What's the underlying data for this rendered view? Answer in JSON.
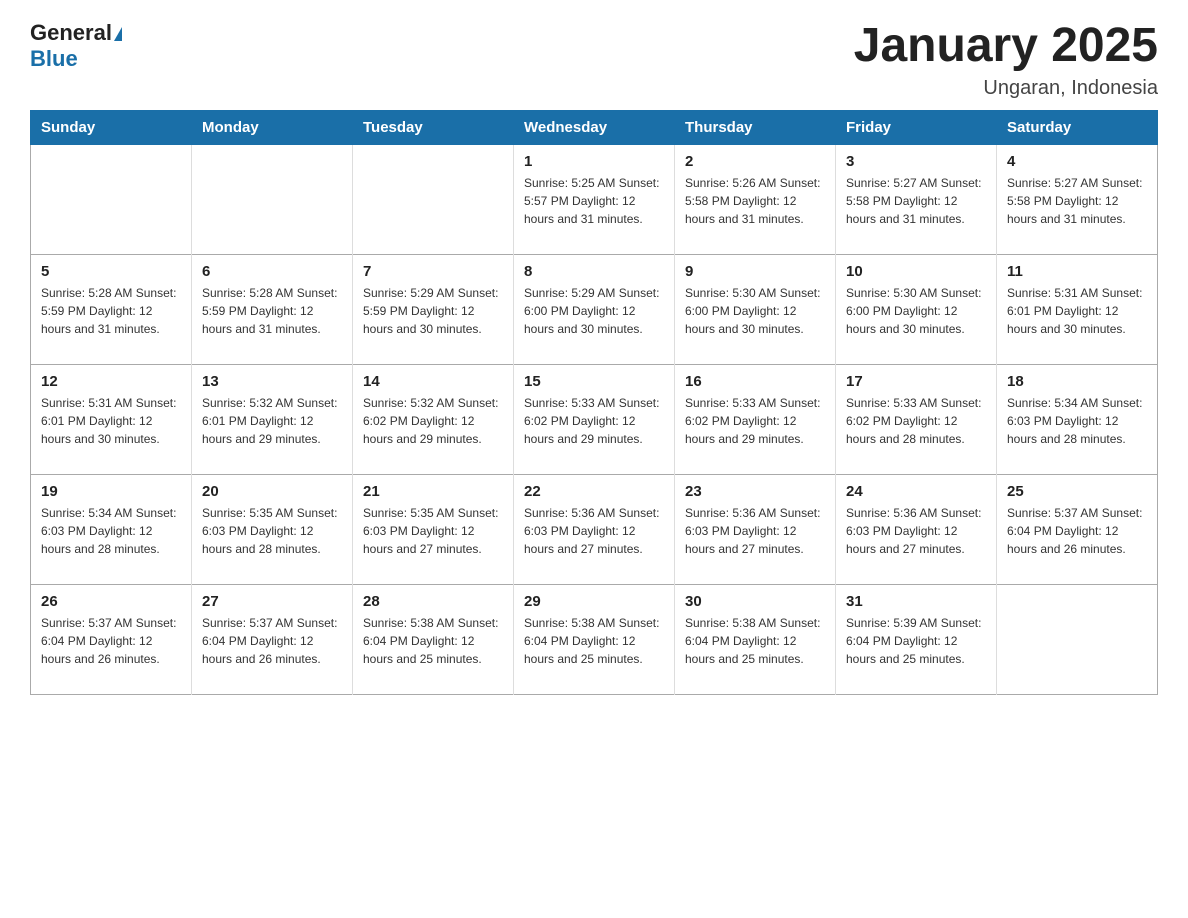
{
  "logo": {
    "text_general": "General",
    "text_blue": "Blue"
  },
  "title": "January 2025",
  "subtitle": "Ungaran, Indonesia",
  "days_of_week": [
    "Sunday",
    "Monday",
    "Tuesday",
    "Wednesday",
    "Thursday",
    "Friday",
    "Saturday"
  ],
  "weeks": [
    [
      {
        "day": "",
        "info": ""
      },
      {
        "day": "",
        "info": ""
      },
      {
        "day": "",
        "info": ""
      },
      {
        "day": "1",
        "info": "Sunrise: 5:25 AM\nSunset: 5:57 PM\nDaylight: 12 hours and 31 minutes."
      },
      {
        "day": "2",
        "info": "Sunrise: 5:26 AM\nSunset: 5:58 PM\nDaylight: 12 hours and 31 minutes."
      },
      {
        "day": "3",
        "info": "Sunrise: 5:27 AM\nSunset: 5:58 PM\nDaylight: 12 hours and 31 minutes."
      },
      {
        "day": "4",
        "info": "Sunrise: 5:27 AM\nSunset: 5:58 PM\nDaylight: 12 hours and 31 minutes."
      }
    ],
    [
      {
        "day": "5",
        "info": "Sunrise: 5:28 AM\nSunset: 5:59 PM\nDaylight: 12 hours and 31 minutes."
      },
      {
        "day": "6",
        "info": "Sunrise: 5:28 AM\nSunset: 5:59 PM\nDaylight: 12 hours and 31 minutes."
      },
      {
        "day": "7",
        "info": "Sunrise: 5:29 AM\nSunset: 5:59 PM\nDaylight: 12 hours and 30 minutes."
      },
      {
        "day": "8",
        "info": "Sunrise: 5:29 AM\nSunset: 6:00 PM\nDaylight: 12 hours and 30 minutes."
      },
      {
        "day": "9",
        "info": "Sunrise: 5:30 AM\nSunset: 6:00 PM\nDaylight: 12 hours and 30 minutes."
      },
      {
        "day": "10",
        "info": "Sunrise: 5:30 AM\nSunset: 6:00 PM\nDaylight: 12 hours and 30 minutes."
      },
      {
        "day": "11",
        "info": "Sunrise: 5:31 AM\nSunset: 6:01 PM\nDaylight: 12 hours and 30 minutes."
      }
    ],
    [
      {
        "day": "12",
        "info": "Sunrise: 5:31 AM\nSunset: 6:01 PM\nDaylight: 12 hours and 30 minutes."
      },
      {
        "day": "13",
        "info": "Sunrise: 5:32 AM\nSunset: 6:01 PM\nDaylight: 12 hours and 29 minutes."
      },
      {
        "day": "14",
        "info": "Sunrise: 5:32 AM\nSunset: 6:02 PM\nDaylight: 12 hours and 29 minutes."
      },
      {
        "day": "15",
        "info": "Sunrise: 5:33 AM\nSunset: 6:02 PM\nDaylight: 12 hours and 29 minutes."
      },
      {
        "day": "16",
        "info": "Sunrise: 5:33 AM\nSunset: 6:02 PM\nDaylight: 12 hours and 29 minutes."
      },
      {
        "day": "17",
        "info": "Sunrise: 5:33 AM\nSunset: 6:02 PM\nDaylight: 12 hours and 28 minutes."
      },
      {
        "day": "18",
        "info": "Sunrise: 5:34 AM\nSunset: 6:03 PM\nDaylight: 12 hours and 28 minutes."
      }
    ],
    [
      {
        "day": "19",
        "info": "Sunrise: 5:34 AM\nSunset: 6:03 PM\nDaylight: 12 hours and 28 minutes."
      },
      {
        "day": "20",
        "info": "Sunrise: 5:35 AM\nSunset: 6:03 PM\nDaylight: 12 hours and 28 minutes."
      },
      {
        "day": "21",
        "info": "Sunrise: 5:35 AM\nSunset: 6:03 PM\nDaylight: 12 hours and 27 minutes."
      },
      {
        "day": "22",
        "info": "Sunrise: 5:36 AM\nSunset: 6:03 PM\nDaylight: 12 hours and 27 minutes."
      },
      {
        "day": "23",
        "info": "Sunrise: 5:36 AM\nSunset: 6:03 PM\nDaylight: 12 hours and 27 minutes."
      },
      {
        "day": "24",
        "info": "Sunrise: 5:36 AM\nSunset: 6:03 PM\nDaylight: 12 hours and 27 minutes."
      },
      {
        "day": "25",
        "info": "Sunrise: 5:37 AM\nSunset: 6:04 PM\nDaylight: 12 hours and 26 minutes."
      }
    ],
    [
      {
        "day": "26",
        "info": "Sunrise: 5:37 AM\nSunset: 6:04 PM\nDaylight: 12 hours and 26 minutes."
      },
      {
        "day": "27",
        "info": "Sunrise: 5:37 AM\nSunset: 6:04 PM\nDaylight: 12 hours and 26 minutes."
      },
      {
        "day": "28",
        "info": "Sunrise: 5:38 AM\nSunset: 6:04 PM\nDaylight: 12 hours and 25 minutes."
      },
      {
        "day": "29",
        "info": "Sunrise: 5:38 AM\nSunset: 6:04 PM\nDaylight: 12 hours and 25 minutes."
      },
      {
        "day": "30",
        "info": "Sunrise: 5:38 AM\nSunset: 6:04 PM\nDaylight: 12 hours and 25 minutes."
      },
      {
        "day": "31",
        "info": "Sunrise: 5:39 AM\nSunset: 6:04 PM\nDaylight: 12 hours and 25 minutes."
      },
      {
        "day": "",
        "info": ""
      }
    ]
  ]
}
